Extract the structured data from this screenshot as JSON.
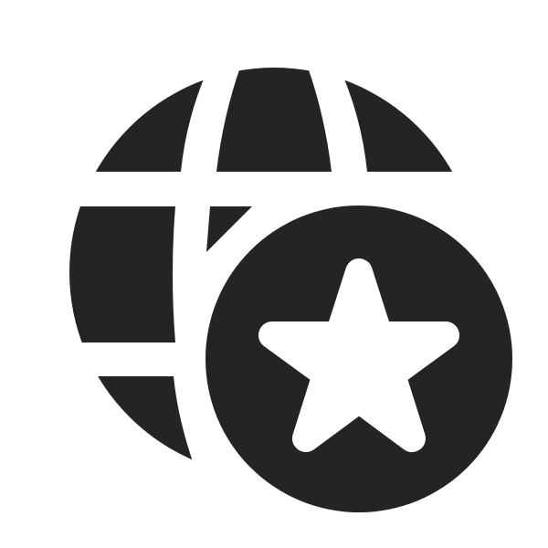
{
  "icon": {
    "name": "globe-star-icon",
    "parts": [
      "globe-icon",
      "star-icon"
    ],
    "colors": {
      "foreground": "#242424",
      "background": "#ffffff"
    }
  }
}
